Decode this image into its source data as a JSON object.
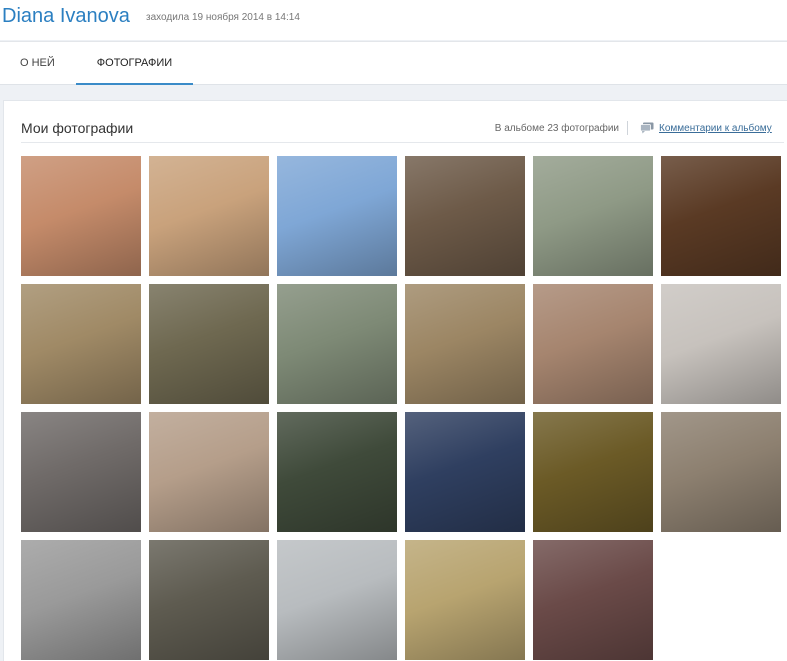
{
  "profile": {
    "name": "Diana Ivanova",
    "last_seen": "заходила 19 ноября 2014 в 14:14"
  },
  "tabs": [
    {
      "label": "О НЕЙ",
      "active": false
    },
    {
      "label": "ФОТОГРАФИИ",
      "active": true
    }
  ],
  "album": {
    "title": "Мои фотографии",
    "count_text": "В альбоме 23 фотографии",
    "comments_link": "Комментарии к альбому",
    "comments_icon": "comment-bubble-icon"
  },
  "colors": {
    "name_blue": "#2b7fc1",
    "tab_active": "#3a8bc8",
    "link": "#3a6d99"
  },
  "photos": [
    {
      "tone": "#c58b6a"
    },
    {
      "tone": "#c9a27c"
    },
    {
      "tone": "#7fa7d6"
    },
    {
      "tone": "#6d5a48"
    },
    {
      "tone": "#8f9a86"
    },
    {
      "tone": "#5a3a24"
    },
    {
      "tone": "#a08a66"
    },
    {
      "tone": "#6e6850"
    },
    {
      "tone": "#7e8a76"
    },
    {
      "tone": "#9c8664"
    },
    {
      "tone": "#a6856f"
    },
    {
      "tone": "#c7c2bd"
    },
    {
      "tone": "#6f6a68"
    },
    {
      "tone": "#b59e8a"
    },
    {
      "tone": "#3f4a3a"
    },
    {
      "tone": "#2f3f60"
    },
    {
      "tone": "#6b5a26"
    },
    {
      "tone": "#8d8070"
    },
    {
      "tone": "#9a9a9a"
    },
    {
      "tone": "#5e5b50"
    },
    {
      "tone": "#b8bcbf"
    },
    {
      "tone": "#b8a470"
    },
    {
      "tone": "#6a4a48"
    }
  ]
}
